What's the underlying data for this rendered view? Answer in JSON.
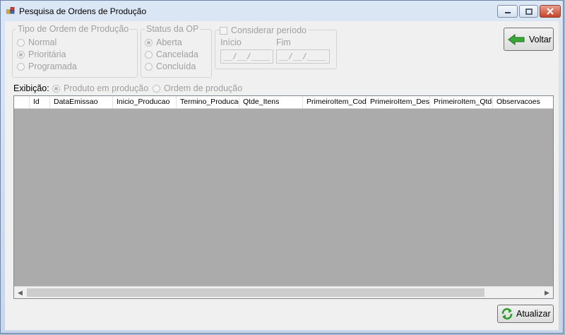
{
  "window": {
    "title": "Pesquisa de Ordens de Produção"
  },
  "tipo_ordem": {
    "legend": "Tipo de Ordem de Produção",
    "options": [
      {
        "label": "Normal",
        "selected": false
      },
      {
        "label": "Prioritária",
        "selected": true
      },
      {
        "label": "Programada",
        "selected": false
      }
    ]
  },
  "status_op": {
    "legend": "Status da OP",
    "options": [
      {
        "label": "Aberta",
        "selected": true
      },
      {
        "label": "Cancelada",
        "selected": false
      },
      {
        "label": "Concluída",
        "selected": false
      }
    ]
  },
  "periodo": {
    "checkbox_label": "Considerar período",
    "checked": false,
    "inicio_label": "Início",
    "fim_label": "Fim",
    "inicio_value": "__/__/____",
    "fim_value": "__/__/____"
  },
  "buttons": {
    "voltar": "Voltar",
    "atualizar": "Atualizar"
  },
  "exibicao": {
    "label": "Exibição:",
    "options": [
      {
        "label": "Produto em produção",
        "selected": true
      },
      {
        "label": "Ordem de produção",
        "selected": false
      }
    ]
  },
  "grid": {
    "columns": [
      "Id",
      "DataEmissao",
      "Inicio_Producao",
      "Termino_Producao",
      "Qtde_Itens",
      "PrimeiroItem_Cod",
      "PrimeiroItem_Desc",
      "PrimeiroItem_Qtde",
      "Observacoes"
    ],
    "rows": []
  },
  "colors": {
    "green_arrow": "#2e9e2e",
    "grid_background": "#ababab",
    "disabled_text": "#a0a0a0"
  }
}
